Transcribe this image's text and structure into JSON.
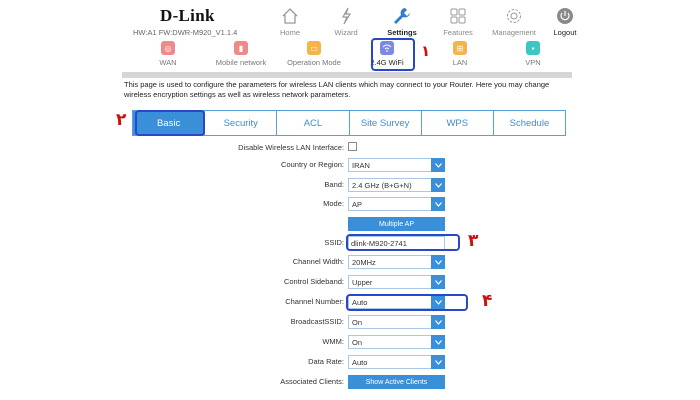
{
  "header": {
    "brand": "D-Link",
    "hw_fw": "HW:A1 FW:DWR-M920_V1.1.4",
    "nav": [
      {
        "label": "Home",
        "icon": "home-icon"
      },
      {
        "label": "Wizard",
        "icon": "wand-icon"
      },
      {
        "label": "Settings",
        "icon": "wrench-icon",
        "active": true
      },
      {
        "label": "Features",
        "icon": "grid-icon"
      },
      {
        "label": "Management",
        "icon": "gear-icon"
      },
      {
        "label": "Logout",
        "icon": "power-icon"
      }
    ]
  },
  "subnav": [
    {
      "label": "WAN",
      "color": "#f08a8a",
      "icon": "globe-icon"
    },
    {
      "label": "Mobile network",
      "color": "#f08a8a",
      "icon": "signal-icon"
    },
    {
      "label": "Operation Mode",
      "color": "#f5b44a",
      "icon": "monitor-icon"
    },
    {
      "label": "2.4G WiFi",
      "color": "#7a88e8",
      "icon": "wifi-icon",
      "active": true
    },
    {
      "label": "LAN",
      "color": "#f5b44a",
      "icon": "network-icon"
    },
    {
      "label": "VPN",
      "color": "#3cc8c0",
      "icon": "lock-icon"
    }
  ],
  "description": "This page is used to configure the parameters for wireless LAN clients which may connect to your Router. Here you may change wireless encryption settings as well as wireless network parameters.",
  "tabs": [
    "Basic",
    "Security",
    "ACL",
    "Site Survey",
    "WPS",
    "Schedule"
  ],
  "annotations": {
    "m1": "۱",
    "m2": "۲",
    "m3": "۳",
    "m4": "۴"
  },
  "form": {
    "disable_label": "Disable Wireless LAN Interface:",
    "country_label": "Country or Region:",
    "country_value": "IRAN",
    "band_label": "Band:",
    "band_value": "2.4 GHz (B+G+N)",
    "mode_label": "Mode:",
    "mode_value": "AP",
    "multiple_ap": "Multiple AP",
    "ssid_label": "SSID:",
    "ssid_value": "dlink-M920-2741",
    "width_label": "Channel Width:",
    "width_value": "20MHz",
    "sideband_label": "Control Sideband:",
    "sideband_value": "Upper",
    "channel_label": "Channel Number:",
    "channel_value": "Auto",
    "broadcast_label": "BroadcastSSID:",
    "broadcast_value": "On",
    "wmm_label": "WMM:",
    "wmm_value": "On",
    "rate_label": "Data Rate:",
    "rate_value": "Auto",
    "clients_label": "Associated Clients:",
    "clients_button": "Show Active Clients"
  }
}
